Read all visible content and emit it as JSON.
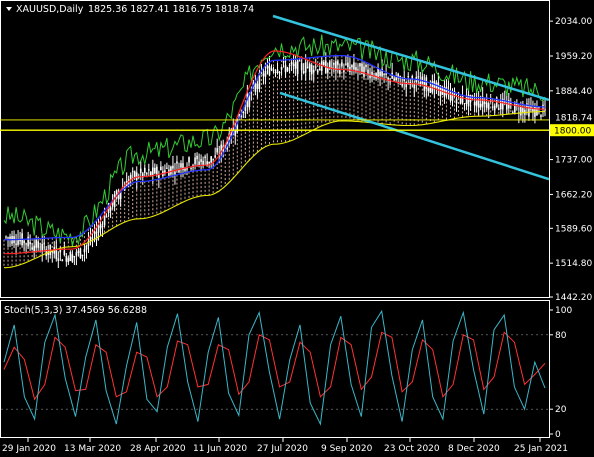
{
  "window": {
    "title": "XAUUSD,Daily",
    "ohlc": "1825.36 1827.41 1816.75 1818.74",
    "menu_icon": "triangle-down-icon"
  },
  "colors": {
    "background": "#000000",
    "bull_candle": "#ffffff",
    "bear_candle": "#ffffff",
    "price_line": "#33cc33",
    "ma_fast": "#ff2222",
    "ma_mid": "#2233ff",
    "ma_slow": "#e6e600",
    "cloud": "#f4c7b6",
    "channel": "#33c3dd",
    "horizontal_level": "#ffff00",
    "stoch_main": "#3ab7c9",
    "stoch_signal": "#ff3333"
  },
  "chart_data": [
    {
      "type": "line",
      "symbol": "XAUUSD",
      "timeframe": "Daily",
      "ohlc_last": {
        "open": 1825.36,
        "high": 1827.41,
        "low": 1816.75,
        "close": 1818.74
      },
      "x_tick_labels": [
        "29 Jan 2020",
        "13 Mar 2020",
        "28 Apr 2020",
        "11 Jun 2020",
        "27 Jul 2020",
        "9 Sep 2020",
        "23 Oct 2020",
        "8 Dec 2020",
        "25 Jan 2021"
      ],
      "y_tick_labels": [
        "2034.00",
        "1959.20",
        "1884.40",
        "1818.74",
        "1800.00",
        "1737.00",
        "1662.20",
        "1589.60",
        "1514.80",
        "1442.20"
      ],
      "ylim": [
        1442.2,
        2060
      ],
      "current_price_label": "1818.74",
      "level_label": "1800.00",
      "horizontal_level": 1800.0,
      "x": [
        "29 Jan 2020",
        "13 Mar 2020",
        "28 Apr 2020",
        "11 Jun 2020",
        "27 Jul 2020",
        "9 Sep 2020",
        "23 Oct 2020",
        "8 Dec 2020",
        "25 Jan 2021"
      ],
      "series": [
        {
          "values": [
            1570,
            1530,
            1705,
            1735,
            1935,
            1935,
            1905,
            1860,
            1840
          ]
        },
        {
          "values": [
            1535,
            1545,
            1700,
            1725,
            1970,
            1930,
            1900,
            1865,
            1845
          ]
        },
        {
          "values": [
            1565,
            1570,
            1690,
            1715,
            1950,
            1960,
            1910,
            1870,
            1850
          ]
        },
        {
          "values": [
            1505,
            1550,
            1610,
            1660,
            1770,
            1820,
            1810,
            1830,
            1840
          ]
        }
      ],
      "channel": {
        "upper": {
          "from": [
            "27 Jul 2020",
            2045
          ],
          "to": [
            "25 Jan 2021",
            1865
          ]
        },
        "lower": {
          "from": [
            "27 Jul 2020",
            1880
          ],
          "to": [
            "25 Jan 2021",
            1695
          ]
        }
      },
      "grid": false
    },
    {
      "type": "line",
      "title": "Stoch(5,3,3) 37.4569 56.6288",
      "y_tick_labels": [
        "100",
        "80",
        "20",
        "0"
      ],
      "ylim": [
        0,
        100
      ],
      "levels": [
        20,
        80
      ],
      "series": [
        {
          "name": "Main",
          "last": 37.4569,
          "values": [
            58,
            88,
            30,
            12,
            74,
            96,
            45,
            14,
            62,
            92,
            35,
            8,
            55,
            90,
            28,
            18,
            70,
            97,
            42,
            10,
            66,
            94,
            33,
            15,
            80,
            98,
            50,
            12,
            60,
            88,
            25,
            8,
            72,
            95,
            40,
            14,
            86,
            99,
            47,
            10,
            68,
            92,
            30,
            12,
            75,
            98,
            52,
            16,
            84,
            96,
            38,
            20,
            58,
            37
          ]
        },
        {
          "name": "Signal",
          "last": 56.6288,
          "values": [
            52,
            70,
            60,
            28,
            40,
            78,
            70,
            35,
            36,
            72,
            66,
            30,
            34,
            66,
            62,
            30,
            38,
            75,
            72,
            38,
            40,
            72,
            68,
            32,
            42,
            80,
            76,
            38,
            42,
            74,
            66,
            30,
            38,
            78,
            72,
            36,
            46,
            82,
            78,
            34,
            42,
            76,
            68,
            30,
            40,
            80,
            76,
            36,
            46,
            82,
            74,
            40,
            48,
            57
          ]
        }
      ]
    }
  ],
  "sub_window": {
    "title": "Stoch(5,3,3) 37.4569 56.6288"
  }
}
